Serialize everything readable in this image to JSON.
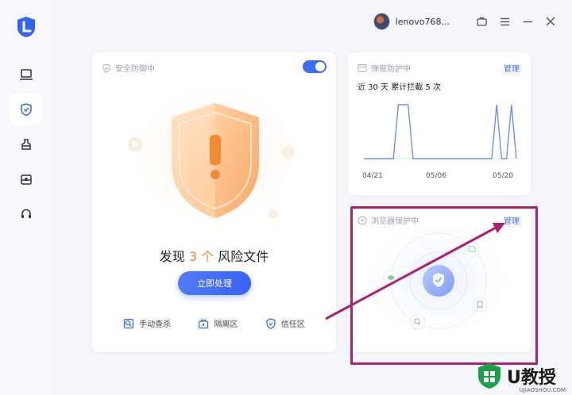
{
  "titlebar": {
    "username": "lenovo768..."
  },
  "sidebar": {
    "items": [
      {
        "icon": "laptop-icon"
      },
      {
        "icon": "shield-icon"
      },
      {
        "icon": "broom-icon"
      },
      {
        "icon": "toolbox-icon"
      },
      {
        "icon": "headset-icon"
      }
    ]
  },
  "security": {
    "status": "安全防御中",
    "enabled": true,
    "risk_prefix": "发现",
    "risk_count": "3 个",
    "risk_suffix": "风险文件",
    "action_label": "立即处理",
    "tools": [
      {
        "label": "手动查杀"
      },
      {
        "label": "隔离区"
      },
      {
        "label": "信任区"
      }
    ]
  },
  "popup": {
    "title": "弹窗防护中",
    "manage_label": "管理",
    "summary": "近 30 天 累计拦截 5 次"
  },
  "browser": {
    "title": "浏览器保护中",
    "manage_label": "管理"
  },
  "chart_data": {
    "type": "line",
    "x_tick_labels": [
      "04/21",
      "05/06",
      "05/20"
    ],
    "values": [
      0,
      0,
      0,
      0,
      0,
      0,
      0,
      1,
      1,
      1,
      0,
      0,
      0,
      0,
      0,
      0,
      0,
      0,
      0,
      0,
      0,
      0,
      0,
      0,
      0,
      0,
      0,
      1,
      0,
      0,
      1,
      0
    ]
  },
  "colors": {
    "accent": "#3b6cf6",
    "risk": "#f08a3a",
    "annotation": "#b0206f"
  },
  "watermark": {
    "brand": "U教授",
    "site": "UJIAOSHOU.COM"
  }
}
